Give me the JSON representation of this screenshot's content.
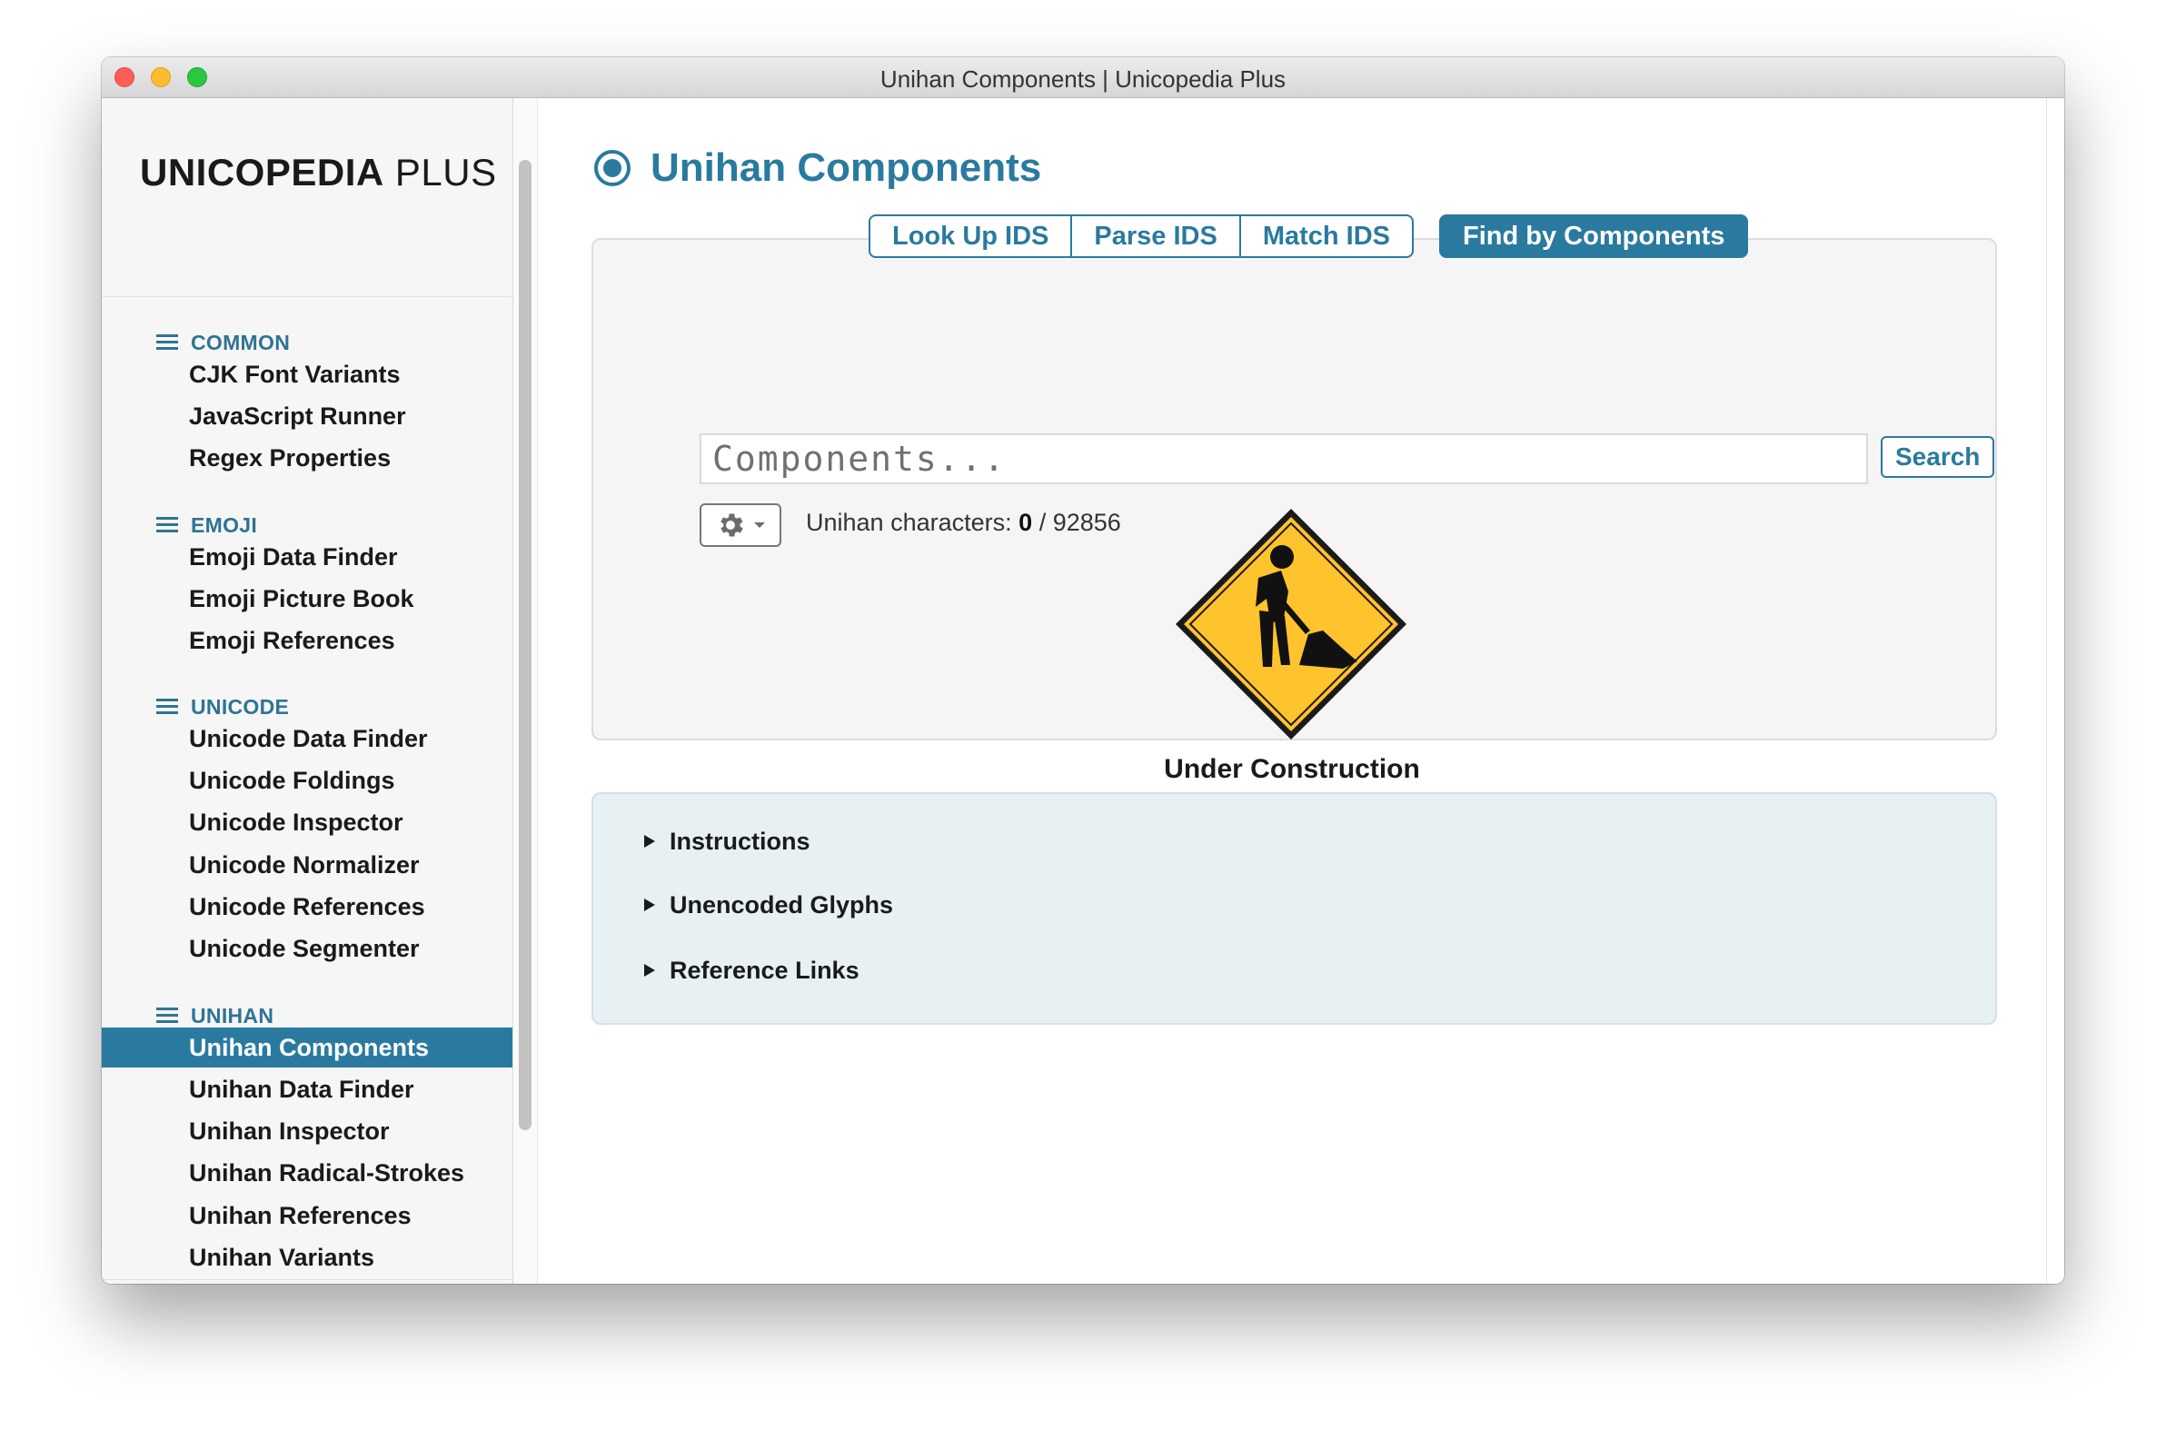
{
  "window": {
    "title": "Unihan Components | Unicopedia Plus"
  },
  "brand": {
    "bold": "UNICOPEDIA",
    "light": "PLUS"
  },
  "sidebar": {
    "sections": [
      {
        "heading": "COMMON",
        "items": [
          "CJK Font Variants",
          "JavaScript Runner",
          "Regex Properties"
        ]
      },
      {
        "heading": "EMOJI",
        "items": [
          "Emoji Data Finder",
          "Emoji Picture Book",
          "Emoji References"
        ]
      },
      {
        "heading": "UNICODE",
        "items": [
          "Unicode Data Finder",
          "Unicode Foldings",
          "Unicode Inspector",
          "Unicode Normalizer",
          "Unicode References",
          "Unicode Segmenter"
        ]
      },
      {
        "heading": "UNIHAN",
        "items": [
          "Unihan Components",
          "Unihan Data Finder",
          "Unihan Inspector",
          "Unihan Radical-Strokes",
          "Unihan References",
          "Unihan Variants"
        ]
      }
    ],
    "active_item": "Unihan Components"
  },
  "main": {
    "title": "Unihan Components",
    "tabs": [
      {
        "label": "Look Up IDS",
        "selected": false
      },
      {
        "label": "Parse IDS",
        "selected": false
      },
      {
        "label": "Match IDS",
        "selected": false
      },
      {
        "label": "Find by Components",
        "selected": true
      }
    ],
    "search": {
      "placeholder": "Components...",
      "value": "",
      "button_label": "Search"
    },
    "options_icon": "gear-icon",
    "count": {
      "label": "Unihan characters:",
      "matched": "0",
      "separator": "/",
      "total": "92856"
    },
    "construction": {
      "icon": "under-construction-sign-icon",
      "label": "Under Construction"
    },
    "disclosures": [
      "Instructions",
      "Unencoded Glyphs",
      "Reference Links"
    ]
  },
  "colors": {
    "accent": "#2a7aa0",
    "sign_yellow": "#fec32d",
    "info_bg": "#e7f0f3"
  }
}
